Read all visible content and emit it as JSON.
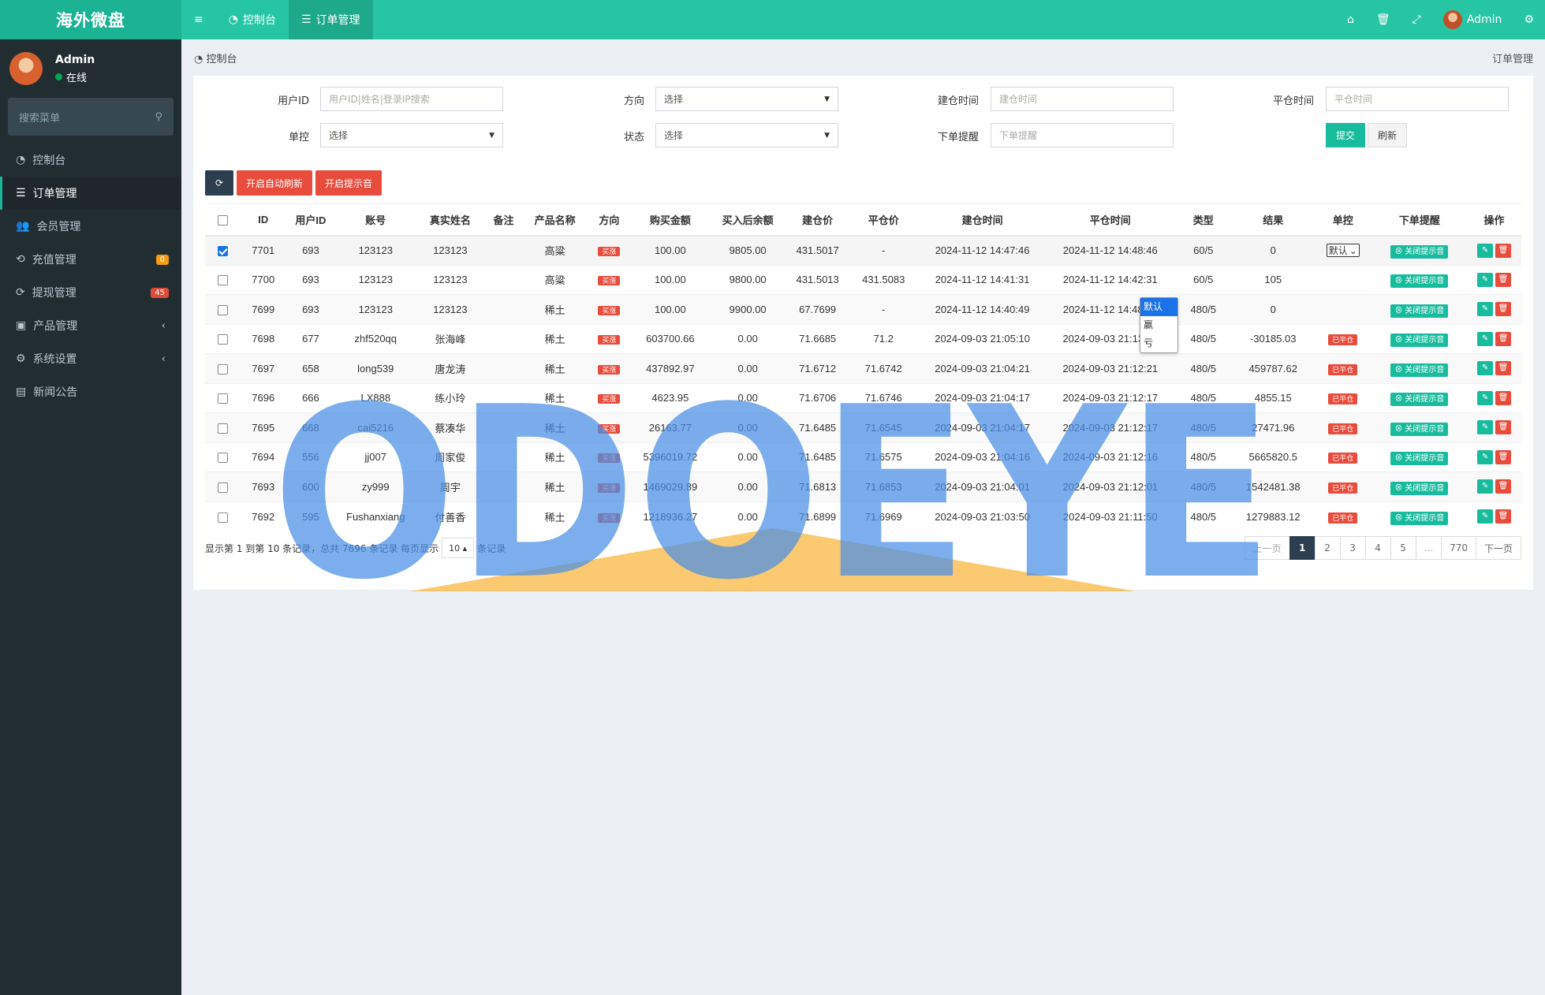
{
  "app": {
    "title": "海外微盘"
  },
  "topbar": {
    "menu_toggle": "≡",
    "tabs": [
      {
        "label": "控制台",
        "icon": "dashboard-icon"
      },
      {
        "label": "订单管理",
        "icon": "list-icon"
      }
    ],
    "user": "Admin"
  },
  "sidebar": {
    "user_name": "Admin",
    "user_status": "在线",
    "search_placeholder": "搜索菜单",
    "items": [
      {
        "label": "控制台",
        "icon": "dashboard-icon"
      },
      {
        "label": "订单管理",
        "icon": "list-icon",
        "active": true
      },
      {
        "label": "会员管理",
        "icon": "users-icon"
      },
      {
        "label": "充值管理",
        "icon": "recharge-icon",
        "badge": "0",
        "badge_color": "#f39c12"
      },
      {
        "label": "提现管理",
        "icon": "withdraw-icon",
        "badge": "45",
        "badge_color": "#dd4b39"
      },
      {
        "label": "产品管理",
        "icon": "product-icon",
        "arrow": "‹"
      },
      {
        "label": "系统设置",
        "icon": "settings-icon",
        "arrow": "‹"
      },
      {
        "label": "新闻公告",
        "icon": "news-icon"
      }
    ]
  },
  "breadcrumb": {
    "left": "控制台",
    "right": "订单管理"
  },
  "filters": {
    "user_id": {
      "label": "用户ID",
      "placeholder": "用户ID|姓名|登录IP搜索"
    },
    "direction": {
      "label": "方向",
      "value": "选择"
    },
    "open_time": {
      "label": "建仓时间",
      "placeholder": "建仓时间"
    },
    "close_time": {
      "label": "平仓时间",
      "placeholder": "平仓时间"
    },
    "control": {
      "label": "单控",
      "value": "选择"
    },
    "status": {
      "label": "状态",
      "value": "选择"
    },
    "order_alert": {
      "label": "下单提醒",
      "placeholder": "下单提醒"
    },
    "submit": "提交",
    "refresh": "刷新"
  },
  "toolbar": {
    "refresh_icon": "⟳",
    "auto_refresh": "开启自动刷新",
    "sound": "开启提示音"
  },
  "table": {
    "headers": [
      "ID",
      "用户ID",
      "账号",
      "真实姓名",
      "备注",
      "产品名称",
      "方向",
      "购买金额",
      "买入后余额",
      "建仓价",
      "平仓价",
      "建仓时间",
      "平仓时间",
      "类型",
      "结果",
      "单控",
      "下单提醒",
      "操作"
    ],
    "direction_label": "买涨",
    "closed_label": "已平仓",
    "alert_label": "关闭提示音",
    "control_default": "默认",
    "rows": [
      {
        "id": "7701",
        "uid": "693",
        "account": "123123",
        "name": "123123",
        "note": "",
        "product": "高粱",
        "amount": "100.00",
        "balance": "9805.00",
        "open": "431.5017",
        "close": "-",
        "open_time": "2024-11-12 14:47:46",
        "close_time": "2024-11-12 14:48:46",
        "type": "60/5",
        "result": "0",
        "checked": true,
        "ctrl": "select"
      },
      {
        "id": "7700",
        "uid": "693",
        "account": "123123",
        "name": "123123",
        "note": "",
        "product": "高粱",
        "amount": "100.00",
        "balance": "9800.00",
        "open": "431.5013",
        "close": "431.5083",
        "open_time": "2024-11-12 14:41:31",
        "close_time": "2024-11-12 14:42:31",
        "type": "60/5",
        "result": "105",
        "checked": false,
        "ctrl": "none"
      },
      {
        "id": "7699",
        "uid": "693",
        "account": "123123",
        "name": "123123",
        "note": "",
        "product": "稀土",
        "amount": "100.00",
        "balance": "9900.00",
        "open": "67.7699",
        "close": "-",
        "open_time": "2024-11-12 14:40:49",
        "close_time": "2024-11-12 14:48:49",
        "type": "480/5",
        "result": "0",
        "checked": false,
        "ctrl": "none"
      },
      {
        "id": "7698",
        "uid": "677",
        "account": "zhf520qq",
        "name": "张海峰",
        "note": "",
        "product": "稀土",
        "amount": "603700.66",
        "balance": "0.00",
        "open": "71.6685",
        "close": "71.2",
        "open_time": "2024-09-03 21:05:10",
        "close_time": "2024-09-03 21:13:10",
        "type": "480/5",
        "result": "-30185.03",
        "checked": false,
        "ctrl": "closed"
      },
      {
        "id": "7697",
        "uid": "658",
        "account": "long539",
        "name": "唐龙涛",
        "note": "",
        "product": "稀土",
        "amount": "437892.97",
        "balance": "0.00",
        "open": "71.6712",
        "close": "71.6742",
        "open_time": "2024-09-03 21:04:21",
        "close_time": "2024-09-03 21:12:21",
        "type": "480/5",
        "result": "459787.62",
        "checked": false,
        "ctrl": "closed"
      },
      {
        "id": "7696",
        "uid": "666",
        "account": "LX888",
        "name": "练小玲",
        "note": "",
        "product": "稀土",
        "amount": "4623.95",
        "balance": "0.00",
        "open": "71.6706",
        "close": "71.6746",
        "open_time": "2024-09-03 21:04:17",
        "close_time": "2024-09-03 21:12:17",
        "type": "480/5",
        "result": "4855.15",
        "checked": false,
        "ctrl": "closed"
      },
      {
        "id": "7695",
        "uid": "668",
        "account": "cai5216",
        "name": "蔡凑华",
        "note": "",
        "product": "稀土",
        "amount": "26163.77",
        "balance": "0.00",
        "open": "71.6485",
        "close": "71.6545",
        "open_time": "2024-09-03 21:04:17",
        "close_time": "2024-09-03 21:12:17",
        "type": "480/5",
        "result": "27471.96",
        "checked": false,
        "ctrl": "closed"
      },
      {
        "id": "7694",
        "uid": "556",
        "account": "jj007",
        "name": "周家俊",
        "note": "",
        "product": "稀土",
        "amount": "5396019.72",
        "balance": "0.00",
        "open": "71.6485",
        "close": "71.6575",
        "open_time": "2024-09-03 21:04:16",
        "close_time": "2024-09-03 21:12:16",
        "type": "480/5",
        "result": "5665820.5",
        "checked": false,
        "ctrl": "closed"
      },
      {
        "id": "7693",
        "uid": "600",
        "account": "zy999",
        "name": "周宇",
        "note": "",
        "product": "稀土",
        "amount": "1469029.89",
        "balance": "0.00",
        "open": "71.6813",
        "close": "71.6853",
        "open_time": "2024-09-03 21:04:01",
        "close_time": "2024-09-03 21:12:01",
        "type": "480/5",
        "result": "1542481.38",
        "checked": false,
        "ctrl": "closed"
      },
      {
        "id": "7692",
        "uid": "595",
        "account": "Fushanxiang",
        "name": "付善香",
        "note": "",
        "product": "稀土",
        "amount": "1218936.27",
        "balance": "0.00",
        "open": "71.6899",
        "close": "71.6969",
        "open_time": "2024-09-03 21:03:50",
        "close_time": "2024-09-03 21:11:50",
        "type": "480/5",
        "result": "1279883.12",
        "checked": false,
        "ctrl": "closed"
      }
    ]
  },
  "dropdown": {
    "options": [
      "默认",
      "赢",
      "亏"
    ],
    "selected": "默认"
  },
  "footer": {
    "summary": "显示第 1 到第 10 条记录，总共 7696 条记录 每页显示",
    "page_size": "10",
    "suffix": "条记录",
    "prev": "上一页",
    "pages": [
      "1",
      "2",
      "3",
      "4",
      "5",
      "...",
      "770"
    ],
    "current": "1",
    "next": "下一页"
  },
  "watermark": {
    "text": "ODOEYE",
    "color": "#4a8fe7",
    "accent": "#f9b233"
  }
}
